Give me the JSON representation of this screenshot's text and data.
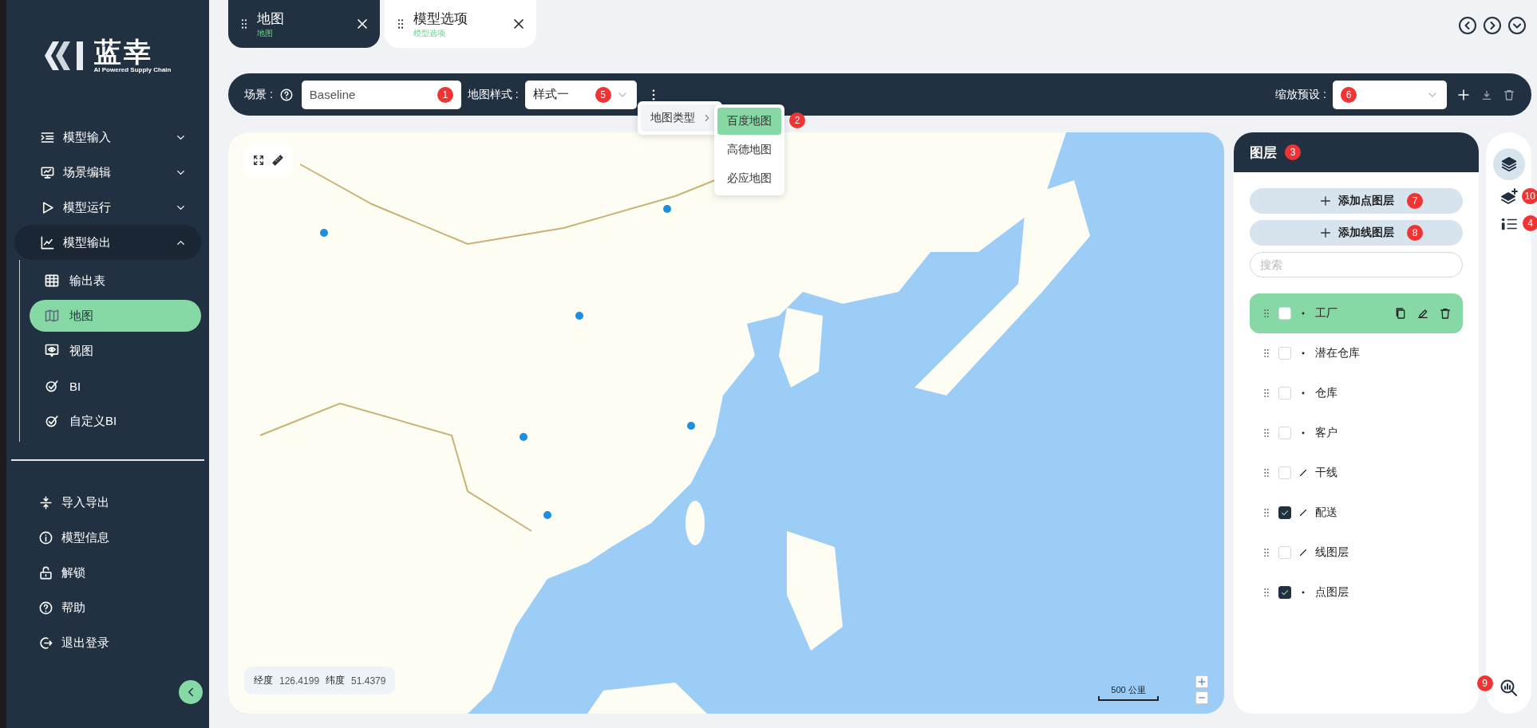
{
  "sidebar": {
    "logo": {
      "name": "蓝幸",
      "tagline": "AI Powered Supply Chain"
    },
    "nav": [
      {
        "label": "模型输入",
        "expanded": false
      },
      {
        "label": "场景编辑",
        "expanded": false
      },
      {
        "label": "模型运行",
        "expanded": false
      },
      {
        "label": "模型输出",
        "expanded": true,
        "children": [
          {
            "label": "输出表",
            "selected": false
          },
          {
            "label": "地图",
            "selected": true
          },
          {
            "label": "视图",
            "selected": false
          },
          {
            "label": "BI",
            "selected": false
          },
          {
            "label": "自定义BI",
            "selected": false
          }
        ]
      }
    ],
    "footer": [
      {
        "label": "导入导出"
      },
      {
        "label": "模型信息"
      },
      {
        "label": "解锁"
      },
      {
        "label": "帮助"
      },
      {
        "label": "退出登录"
      }
    ]
  },
  "tabs": [
    {
      "title": "地图",
      "subtitle": "地图",
      "selected": true
    },
    {
      "title": "模型选项",
      "subtitle": "模型选项",
      "selected": false
    }
  ],
  "toolbar": {
    "scene_label": "场景 :",
    "scene_value": "Baseline",
    "scene_badge": "1",
    "style_label": "地图样式 :",
    "style_value": "样式一",
    "style_badge": "5",
    "zoom_label": "缩放预设 :",
    "zoom_badge": "6"
  },
  "menu": {
    "item": "地图类型",
    "submenu": [
      {
        "label": "百度地图",
        "selected": true
      },
      {
        "label": "高德地图",
        "selected": false
      },
      {
        "label": "必应地图",
        "selected": false
      }
    ],
    "badge": "2"
  },
  "map": {
    "kind": "picture",
    "coords": {
      "lon_label": "经度",
      "lon": "126.4199",
      "lat_label": "纬度",
      "lat": "51.4379"
    },
    "scale": "500 公里"
  },
  "layers_panel": {
    "title": "图层",
    "badge": "3",
    "buttons": [
      {
        "label": "添加点图层",
        "badge": "7"
      },
      {
        "label": "添加线图层",
        "badge": "8"
      }
    ],
    "search_placeholder": "搜索",
    "layers": [
      {
        "name": "工厂",
        "kind": "point",
        "checked": false,
        "selected": true
      },
      {
        "name": "潜在仓库",
        "kind": "point",
        "checked": false,
        "selected": false
      },
      {
        "name": "仓库",
        "kind": "point",
        "checked": false,
        "selected": false
      },
      {
        "name": "客户",
        "kind": "point",
        "checked": false,
        "selected": false
      },
      {
        "name": "干线",
        "kind": "line",
        "checked": false,
        "selected": false
      },
      {
        "name": "配送",
        "kind": "line",
        "checked": true,
        "selected": false
      },
      {
        "name": "线图层",
        "kind": "line",
        "checked": false,
        "selected": false
      },
      {
        "name": "点图层",
        "kind": "point",
        "checked": true,
        "selected": false
      }
    ]
  },
  "rail": {
    "add_badge": "10",
    "legend_badge": "4",
    "analysis_badge": "9"
  }
}
